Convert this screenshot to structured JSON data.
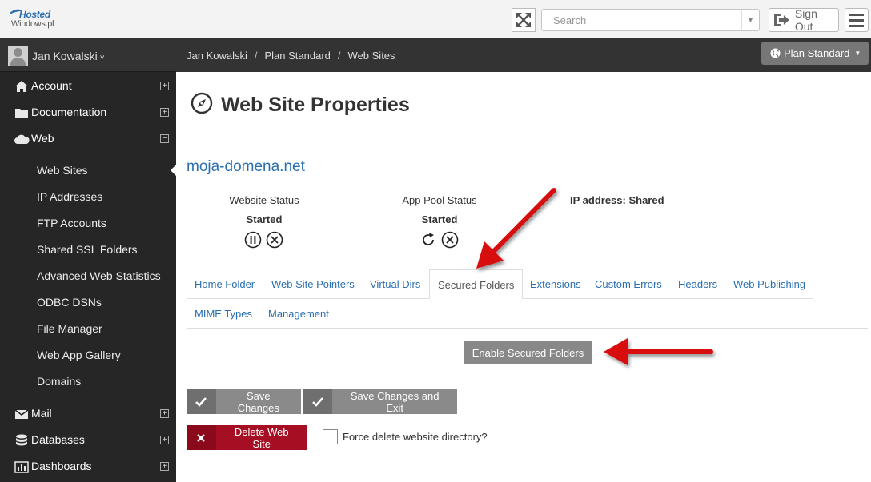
{
  "app": {
    "logo_line1": "Hosted",
    "logo_line2": "Windows.pl"
  },
  "header": {
    "search_placeholder": "Search",
    "sign_out_label": "Sign Out"
  },
  "user": {
    "name": "Jan Kowalski",
    "caret": "˅"
  },
  "sidebar": {
    "items": [
      {
        "label": "Account",
        "icon": "home-icon",
        "toggle": "+"
      },
      {
        "label": "Documentation",
        "icon": "folder-icon",
        "toggle": "+"
      },
      {
        "label": "Web",
        "icon": "cloud-icon",
        "toggle": "−"
      },
      {
        "label": "Mail",
        "icon": "mail-icon",
        "toggle": "+"
      },
      {
        "label": "Databases",
        "icon": "database-icon",
        "toggle": "+"
      },
      {
        "label": "Dashboards",
        "icon": "bar-chart-icon",
        "toggle": "+"
      }
    ],
    "web_subitems": [
      "Web Sites",
      "IP Addresses",
      "FTP Accounts",
      "Shared SSL Folders",
      "Advanced Web Statistics",
      "ODBC DSNs",
      "File Manager",
      "Web App Gallery",
      "Domains"
    ]
  },
  "breadcrumb": {
    "items": [
      "Jan Kowalski",
      "Plan Standard",
      "Web Sites"
    ],
    "separator": "/"
  },
  "plan_button": {
    "label": "Plan Standard"
  },
  "page": {
    "title": "Web Site Properties",
    "domain": "moja-domena.net"
  },
  "status": {
    "website_label": "Website Status",
    "website_value": "Started",
    "app_pool_label": "App Pool Status",
    "app_pool_value": "Started",
    "ip_label": "IP address: Shared"
  },
  "tabs": {
    "row1": [
      "Home Folder",
      "Web Site Pointers",
      "Virtual Dirs",
      "Secured Folders",
      "Extensions",
      "Custom Errors",
      "Headers",
      "Web Publishing"
    ],
    "row2": [
      "MIME Types",
      "Management"
    ],
    "active": "Secured Folders"
  },
  "actions": {
    "enable_secured_folders": "Enable Secured Folders",
    "save_changes": "Save Changes",
    "save_changes_exit": "Save Changes and Exit",
    "delete_site": "Delete Web Site",
    "force_delete_label": "Force delete website directory?"
  },
  "colors": {
    "accent_link": "#2a6fb1",
    "sidebar_bg": "#262626",
    "delete_red": "#a50e23",
    "annotation_arrow": "#d8090c"
  }
}
